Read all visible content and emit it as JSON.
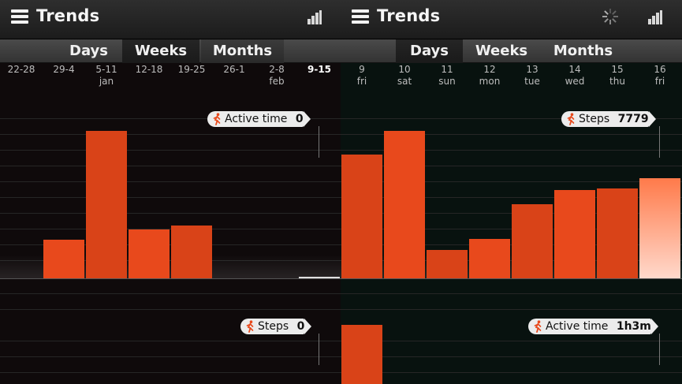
{
  "colors": {
    "bar": "#e8491c",
    "bar_alt": "#d94318",
    "bar_highlight_top": "#ff7a4a",
    "bar_highlight_bottom": "#ffd9cc",
    "accent": "#ff5a1f"
  },
  "icons": {
    "menu": "menu-icon",
    "chart": "bar-chart-icon",
    "loading": "spinner-icon",
    "activity": "runner-icon"
  },
  "left": {
    "title": "Trends",
    "tabs": [
      {
        "label": "Days",
        "state": "normal"
      },
      {
        "label": "Weeks",
        "state": "selected"
      },
      {
        "label": "Months",
        "state": "normal"
      }
    ],
    "columns": [
      {
        "line1": "22-28",
        "line2": ""
      },
      {
        "line1": "29-4",
        "line2": ""
      },
      {
        "line1": "5-11",
        "line2": "jan"
      },
      {
        "line1": "12-18",
        "line2": ""
      },
      {
        "line1": "19-25",
        "line2": ""
      },
      {
        "line1": "26-1",
        "line2": ""
      },
      {
        "line1": "2-8",
        "line2": "feb"
      },
      {
        "line1": "9-15",
        "line2": "",
        "current": true
      }
    ],
    "chart_data": {
      "type": "bar",
      "categories": [
        "22-28",
        "29-4",
        "5-11",
        "12-18",
        "19-25",
        "26-1",
        "2-8",
        "9-15"
      ],
      "values": [
        0,
        0.26,
        1.0,
        0.33,
        0.36,
        0,
        0,
        0
      ],
      "selected_index": 7
    },
    "callout_top": {
      "label": "Active time",
      "value": "0"
    },
    "callout_bottom": {
      "label": "Steps",
      "value": "0"
    },
    "lower_chart_values": [
      0,
      0,
      0,
      0,
      0,
      0,
      0,
      0
    ]
  },
  "right": {
    "title": "Trends",
    "tabs": [
      {
        "label": "Days",
        "state": "selected"
      },
      {
        "label": "Weeks",
        "state": "normal"
      },
      {
        "label": "Months",
        "state": "normal"
      }
    ],
    "columns": [
      {
        "line1": "9",
        "line2": "fri"
      },
      {
        "line1": "10",
        "line2": "sat"
      },
      {
        "line1": "11",
        "line2": "sun"
      },
      {
        "line1": "12",
        "line2": "mon"
      },
      {
        "line1": "13",
        "line2": "tue"
      },
      {
        "line1": "14",
        "line2": "wed"
      },
      {
        "line1": "15",
        "line2": "thu"
      },
      {
        "line1": "16",
        "line2": "fri"
      }
    ],
    "chart_data": {
      "type": "bar",
      "categories": [
        "9 fri",
        "10 sat",
        "11 sun",
        "12 mon",
        "13 tue",
        "14 wed",
        "15 thu",
        "16 fri"
      ],
      "values": [
        0.84,
        1.0,
        0.19,
        0.27,
        0.5,
        0.6,
        0.61,
        0.68
      ],
      "selected_index": 7
    },
    "callout_top": {
      "label": "Steps",
      "value": "7779"
    },
    "callout_bottom": {
      "label": "Active time",
      "value": "1h3m"
    },
    "lower_chart_values": [
      1.0,
      0,
      0,
      0,
      0,
      0,
      0,
      0
    ]
  }
}
